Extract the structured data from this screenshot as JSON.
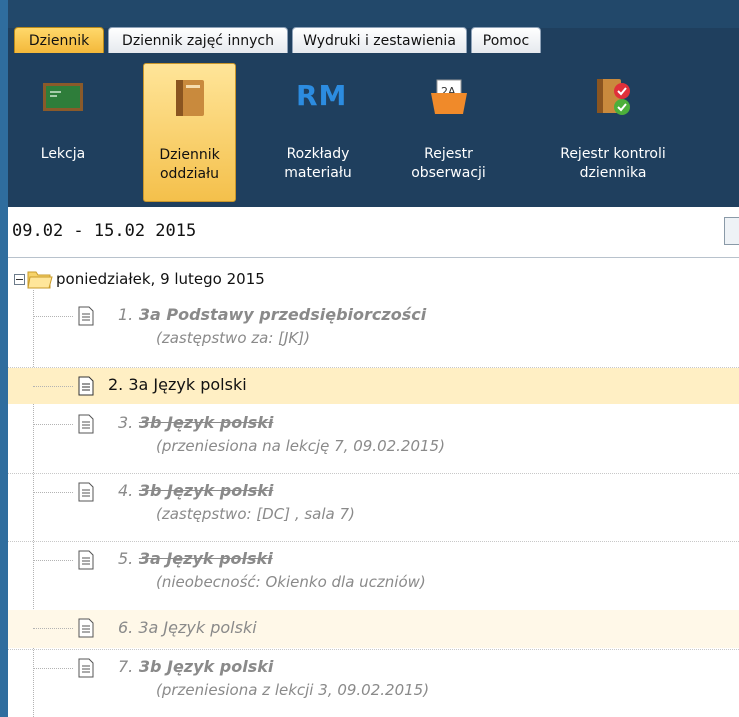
{
  "menu": {
    "tabs": [
      "Dziennik",
      "Dziennik zajęć innych",
      "Wydruki i zestawienia",
      "Pomoc"
    ],
    "active": "Dziennik"
  },
  "ribbon": {
    "buttons": [
      {
        "label": "Lekcja",
        "label2": "",
        "icon": "chalkboard-icon"
      },
      {
        "label": "Dziennik",
        "label2": "oddziału",
        "icon": "class-book-icon",
        "active": true
      },
      {
        "label": "Rozkłady",
        "label2": "materiału",
        "icon": "rm-icon",
        "icon_text": "RM"
      },
      {
        "label": "Rejestr",
        "label2": "obserwacji",
        "icon": "observation-folder-icon",
        "icon_text": "2A"
      },
      {
        "label": "Rejestr kontroli",
        "label2": "dziennika",
        "icon": "control-register-icon"
      }
    ]
  },
  "date_range": "09.02 - 15.02 2015",
  "tree": {
    "day_label": "poniedziałek, 9 lutego 2015",
    "lessons": [
      {
        "num": "1.",
        "title": "3a Podstawy przedsiębiorczości",
        "sub": "(zastępstwo za: [JK])",
        "state": "substituted"
      },
      {
        "num": "2.",
        "title": "3a Język polski",
        "sub": "",
        "state": "selected"
      },
      {
        "num": "3.",
        "title": "3b Język polski",
        "sub": "(przeniesiona na lekcję 7, 09.02.2015)",
        "state": "moved"
      },
      {
        "num": "4.",
        "title": "3b Język polski",
        "sub": "(zastępstwo: [DC] , sala  7)",
        "state": "substituted-out"
      },
      {
        "num": "5.",
        "title": "3a Język polski",
        "sub": "(nieobecność: Okienko dla uczniów)",
        "state": "cancelled"
      },
      {
        "num": "6.",
        "title": "3a Język polski",
        "sub": "",
        "state": "normal"
      },
      {
        "num": "7.",
        "title": "3b Język polski",
        "sub": "(przeniesiona z lekcji 3, 09.02.2015)",
        "state": "moved-in"
      }
    ]
  },
  "colors": {
    "ribbon_bg": "#1f3f5e",
    "active_tab": "#f3b83a",
    "selected_row": "#ffefc4",
    "muted_text": "#8a8a8a"
  }
}
